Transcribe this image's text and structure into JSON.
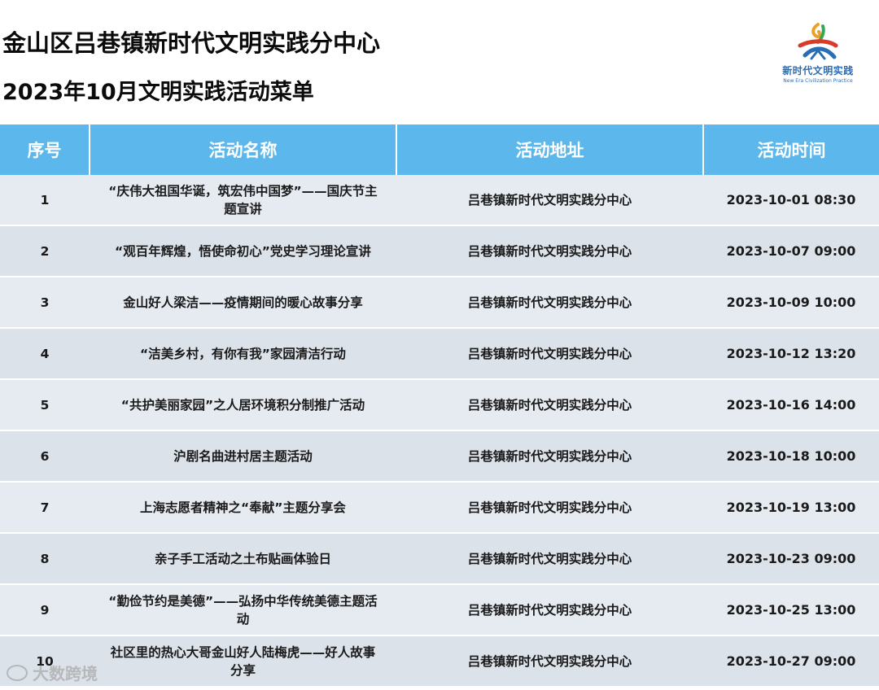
{
  "header": {
    "title": "金山区吕巷镇新时代文明实践分中心",
    "subtitle": "2023年10月文明实践活动菜单"
  },
  "logo": {
    "text_cn": "新时代文明实践",
    "text_en": "New Era Civilization Practice"
  },
  "table": {
    "columns": [
      "序号",
      "活动名称",
      "活动地址",
      "活动时间"
    ],
    "rows": [
      {
        "no": "1",
        "name": "“庆伟大祖国华诞，筑宏伟中国梦”——国庆节主题宣讲",
        "address": "吕巷镇新时代文明实践分中心",
        "time": "2023-10-01 08:30"
      },
      {
        "no": "2",
        "name": "“观百年辉煌，悟使命初心”党史学习理论宣讲",
        "address": "吕巷镇新时代文明实践分中心",
        "time": "2023-10-07 09:00"
      },
      {
        "no": "3",
        "name": "金山好人梁洁——疫情期间的暖心故事分享",
        "address": "吕巷镇新时代文明实践分中心",
        "time": "2023-10-09 10:00"
      },
      {
        "no": "4",
        "name": "“洁美乡村，有你有我”家园清洁行动",
        "address": "吕巷镇新时代文明实践分中心",
        "time": "2023-10-12 13:20"
      },
      {
        "no": "5",
        "name": "“共护美丽家园”之人居环境积分制推广活动",
        "address": "吕巷镇新时代文明实践分中心",
        "time": "2023-10-16 14:00"
      },
      {
        "no": "6",
        "name": "沪剧名曲进村居主题活动",
        "address": "吕巷镇新时代文明实践分中心",
        "time": "2023-10-18 10:00"
      },
      {
        "no": "7",
        "name": "上海志愿者精神之“奉献”主题分享会",
        "address": "吕巷镇新时代文明实践分中心",
        "time": "2023-10-19 13:00"
      },
      {
        "no": "8",
        "name": "亲子手工活动之土布贴画体验日",
        "address": "吕巷镇新时代文明实践分中心",
        "time": "2023-10-23 09:00"
      },
      {
        "no": "9",
        "name": "“勤俭节约是美德”——弘扬中华传统美德主题活动",
        "address": "吕巷镇新时代文明实践分中心",
        "time": "2023-10-25 13:00"
      },
      {
        "no": "10",
        "name": "社区里的热心大哥金山好人陆梅虎——好人故事分享",
        "address": "吕巷镇新时代文明实践分中心",
        "time": "2023-10-27 09:00"
      }
    ]
  },
  "watermark": {
    "text": "大数跨境"
  },
  "colors": {
    "header_bg": "#5cb8ec",
    "row_bg": "#e6ebf2",
    "logo_blue": "#2a6db5"
  }
}
